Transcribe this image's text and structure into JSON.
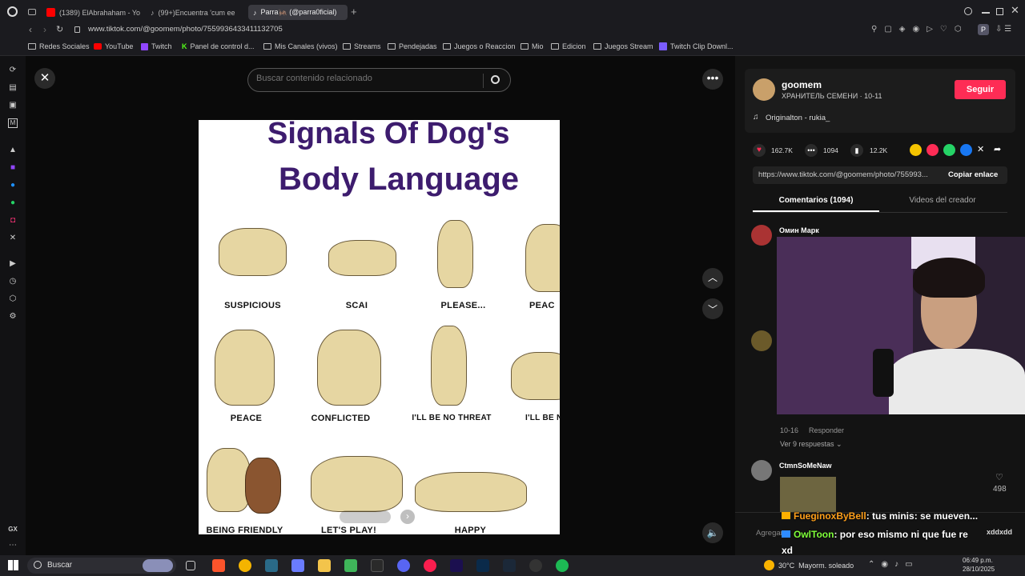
{
  "tabs": [
    {
      "label": "(1389) ElAbrahaham - Yo",
      "color": "#ff0000"
    },
    {
      "label": "(99+)Encuentra 'cum ee",
      "color": "#222222"
    },
    {
      "label": "Parra🦗 (@parra0ficial)",
      "color": "#222222"
    }
  ],
  "address": "www.tiktok.com/@goomem/photo/7559936433411132705",
  "bookmarks": [
    "Redes Sociales",
    "YouTube",
    "Twitch",
    "Panel de control d...",
    "Mis Canales (vivos)",
    "Streams",
    "Pendejadas",
    "Juegos o Reaccion",
    "Mio",
    "Edicion",
    "Juegos Stream",
    "Twitch Clip Downl..."
  ],
  "search": {
    "placeholder": "Buscar contenido relacionado"
  },
  "image": {
    "title_line1": "Signals Of Dog's",
    "title_line2": "Body Language",
    "row1": [
      "SUSPICIOUS",
      "SCAI",
      "PLEASE...",
      "PEAC"
    ],
    "row2": [
      "PEACE",
      "CONFLICTED",
      "I'LL BE NO THREAT",
      "I'LL BE N"
    ],
    "row3": [
      "BEING FRIENDLY",
      "LET'S PLAY!",
      "HAPPY"
    ]
  },
  "author": {
    "name": "goomem",
    "subtitle": "ХРАНИТЕЛЬ СЕМЕНИ · 10-11",
    "follow": "Seguir"
  },
  "music": "Originalton - rukia_",
  "stats": {
    "likes": "162.7K",
    "comments": "1094",
    "saves": "12.2K"
  },
  "link": {
    "url": "https://www.tiktok.com/@goomem/photo/755993...",
    "copy": "Copiar enlace"
  },
  "ptabs": {
    "comments": "Comentarios (1094)",
    "videos": "Videos del creador"
  },
  "comment1": {
    "user": "Омин Марк",
    "date": "10-16",
    "reply": "Responder",
    "more": "Ver 9 respuestas"
  },
  "comment2": {
    "user": "CtmnSoMeNaw",
    "likes": "498"
  },
  "addcomment": "Agregar",
  "chat": [
    {
      "user": "FueginoxByBell",
      "text": ": tus minis: se mueven...",
      "color": "#ff9f1a"
    },
    {
      "user": "OwlToon",
      "text": ": por eso mismo ni que fue re",
      "color": "#7fff3a"
    },
    {
      "user": "",
      "text": "xd",
      "color": "#ffffff"
    }
  ],
  "chat_side": "xddxdd",
  "taskbar": {
    "search": "Buscar",
    "weather": "30°C  Mayorm. soleado",
    "time": "06:49 p.m.",
    "date": "28/10/2025"
  },
  "sidebar_label": "GX"
}
